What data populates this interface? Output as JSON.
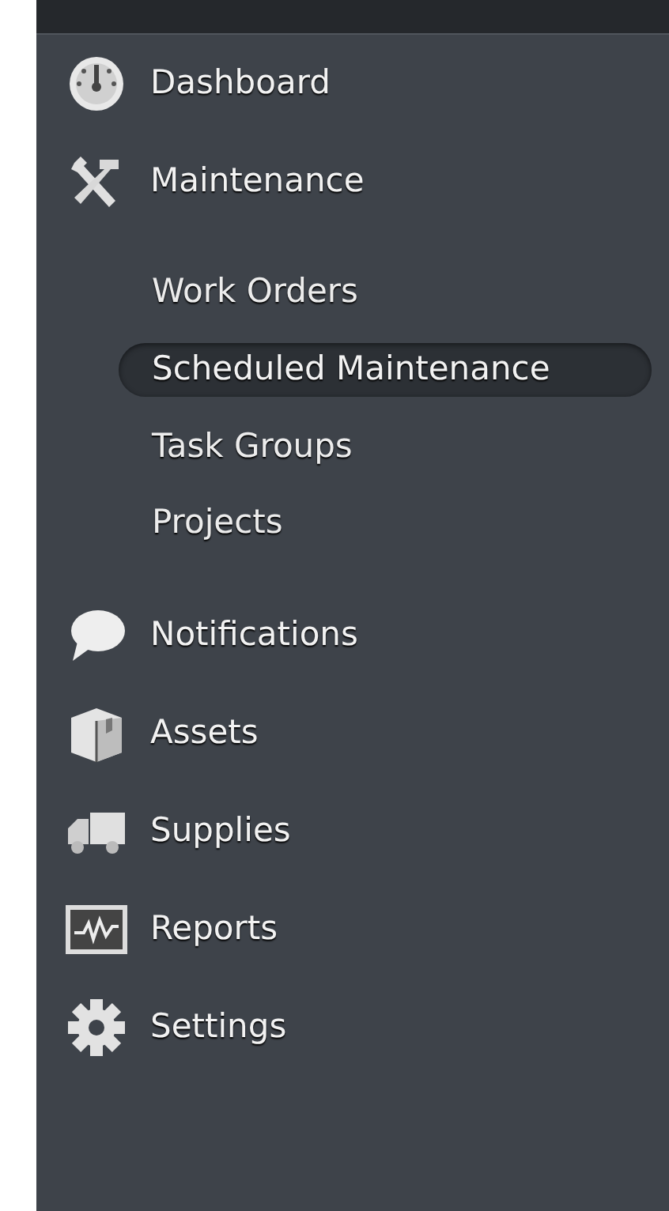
{
  "sidebar": {
    "items": [
      {
        "kind": "gauge",
        "label": "Dashboard"
      },
      {
        "kind": "tools",
        "label": "Maintenance",
        "children": [
          {
            "label": "Work Orders",
            "selected": false
          },
          {
            "label": "Scheduled Maintenance",
            "selected": true
          },
          {
            "label": "Task Groups",
            "selected": false
          },
          {
            "label": "Projects",
            "selected": false
          }
        ]
      },
      {
        "kind": "speech",
        "label": "Notifications"
      },
      {
        "kind": "box",
        "label": "Assets"
      },
      {
        "kind": "truck",
        "label": "Supplies"
      },
      {
        "kind": "chart",
        "label": "Reports"
      },
      {
        "kind": "gear",
        "label": "Settings"
      }
    ]
  }
}
